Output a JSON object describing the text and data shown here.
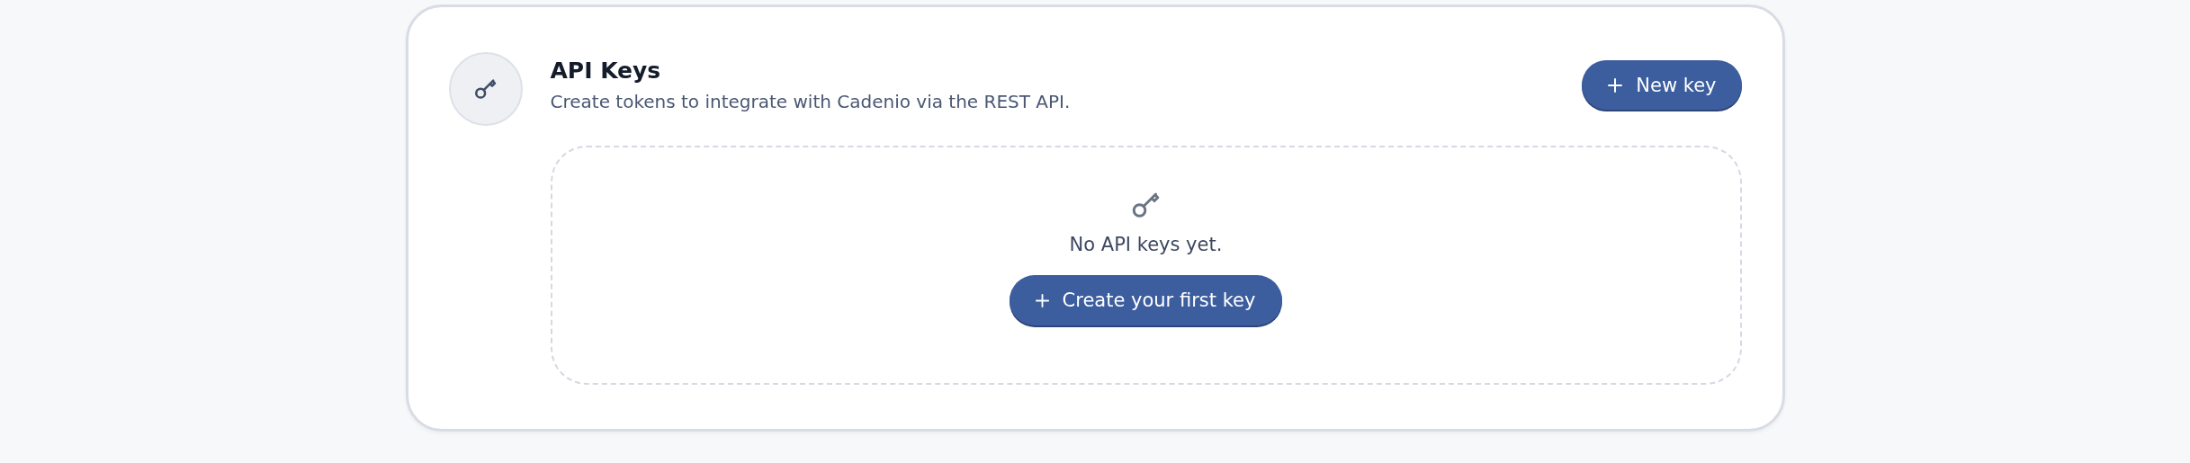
{
  "card": {
    "title": "API Keys",
    "subtitle": "Create tokens to integrate with Cadenio via the REST API.",
    "action_button": {
      "label": "New key"
    }
  },
  "empty_state": {
    "message": "No API keys yet.",
    "button": {
      "label": "Create your first key"
    }
  }
}
